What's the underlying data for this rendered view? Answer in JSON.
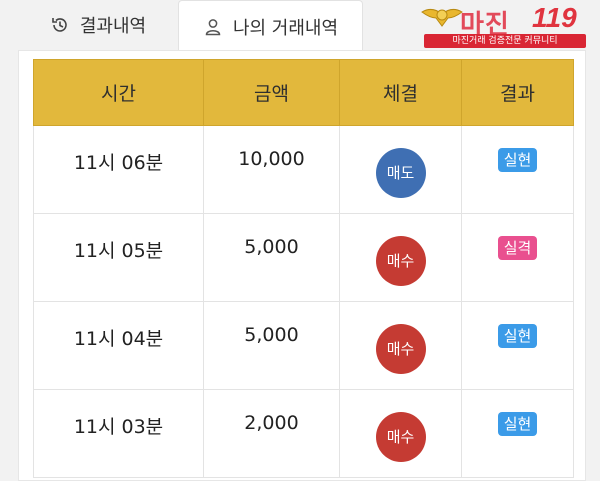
{
  "tabs": {
    "history_label": "결과내역",
    "mine_label": "나의 거래내역"
  },
  "logo": {
    "brand": "마진",
    "number": "119",
    "tagline": "마진거래 검증전문 커뮤니티"
  },
  "table": {
    "headers": [
      "시간",
      "금액",
      "체결",
      "결과"
    ],
    "rows": [
      {
        "time": "11시 06분",
        "amount": "10,000",
        "trade": "매도",
        "result": "실현"
      },
      {
        "time": "11시 05분",
        "amount": "5,000",
        "trade": "매수",
        "result": "실격"
      },
      {
        "time": "11시 04분",
        "amount": "5,000",
        "trade": "매수",
        "result": "실현"
      },
      {
        "time": "11시 03분",
        "amount": "2,000",
        "trade": "매수",
        "result": "실현"
      }
    ]
  },
  "colors": {
    "header_bg": "#e2b83c",
    "sell": "#3f6fb3",
    "buy": "#c53b33",
    "result_hit": "#3b9be8",
    "result_miss": "#e9508f"
  }
}
